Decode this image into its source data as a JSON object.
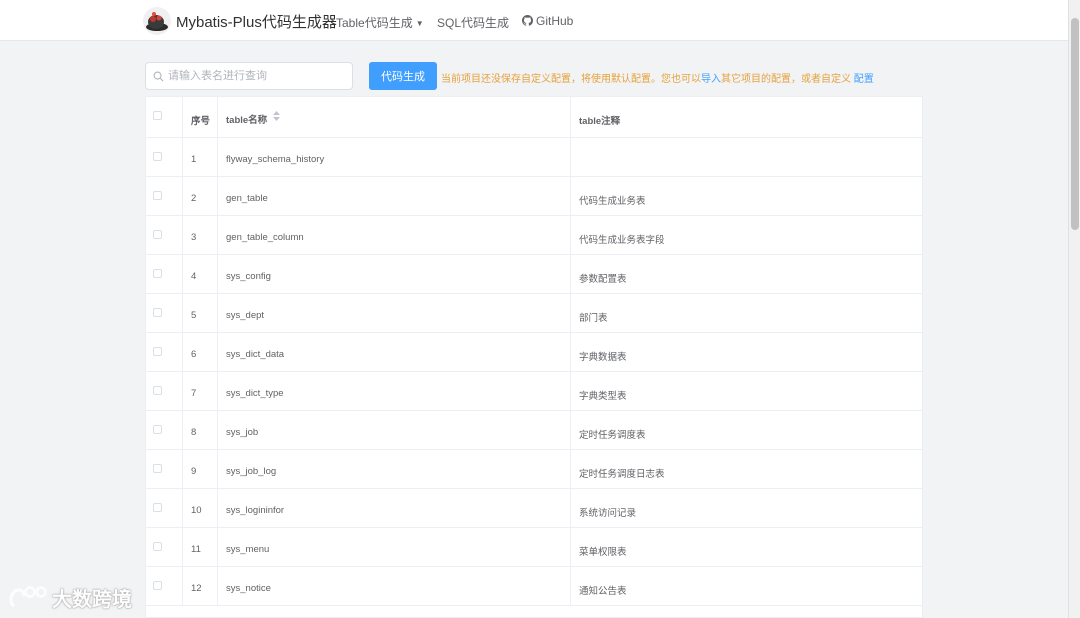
{
  "header": {
    "brand": "Mybatis-Plus代码生成器",
    "nav": {
      "table_gen": "Table代码生成",
      "sql_gen": "SQL代码生成",
      "github": "GitHub"
    }
  },
  "toolbar": {
    "search_placeholder": "请输入表名进行查询",
    "generate_label": "代码生成",
    "notice_part1": "当前项目还没保存自定义配置，将使用默认配置。您也可以",
    "notice_import": "导入",
    "notice_part2": "其它项目的配置，或者自定义",
    "notice_config": "配置"
  },
  "table": {
    "columns": {
      "index": "序号",
      "name": "table名称",
      "comment": "table注释"
    },
    "rows": [
      {
        "idx": "1",
        "name": "flyway_schema_history",
        "comment": ""
      },
      {
        "idx": "2",
        "name": "gen_table",
        "comment": "代码生成业务表"
      },
      {
        "idx": "3",
        "name": "gen_table_column",
        "comment": "代码生成业务表字段"
      },
      {
        "idx": "4",
        "name": "sys_config",
        "comment": "参数配置表"
      },
      {
        "idx": "5",
        "name": "sys_dept",
        "comment": "部门表"
      },
      {
        "idx": "6",
        "name": "sys_dict_data",
        "comment": "字典数据表"
      },
      {
        "idx": "7",
        "name": "sys_dict_type",
        "comment": "字典类型表"
      },
      {
        "idx": "8",
        "name": "sys_job",
        "comment": "定时任务调度表"
      },
      {
        "idx": "9",
        "name": "sys_job_log",
        "comment": "定时任务调度日志表"
      },
      {
        "idx": "10",
        "name": "sys_logininfor",
        "comment": "系统访问记录"
      },
      {
        "idx": "11",
        "name": "sys_menu",
        "comment": "菜单权限表"
      },
      {
        "idx": "12",
        "name": "sys_notice",
        "comment": "通知公告表"
      }
    ]
  },
  "watermark": "大数跨境",
  "colors": {
    "primary": "#409eff",
    "warning": "#e6a23c",
    "border": "#ebeef5",
    "background": "#f2f3f5"
  }
}
